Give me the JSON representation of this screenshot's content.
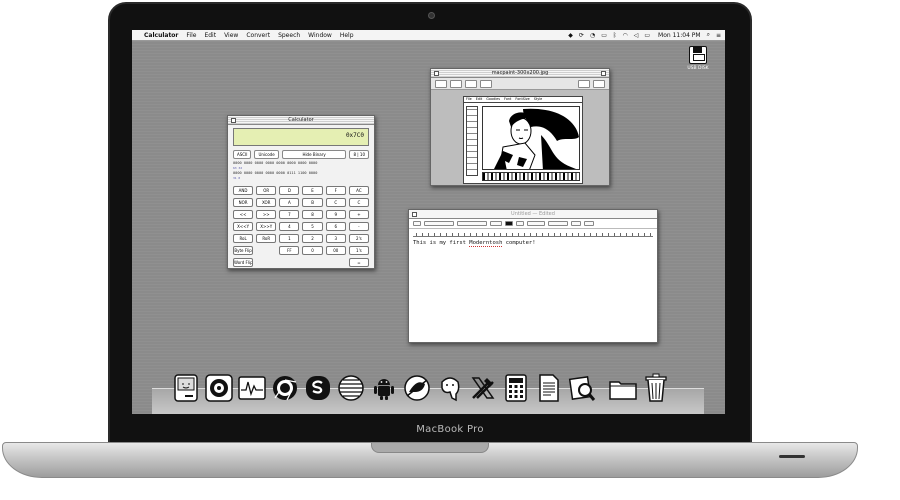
{
  "device": {
    "brand": "MacBook Pro"
  },
  "menubar": {
    "app_name": "Calculator",
    "items": [
      "File",
      "Edit",
      "View",
      "Convert",
      "Speech",
      "Window",
      "Help"
    ],
    "clock": "Mon 11:04 PM"
  },
  "desktop": {
    "disk_label": "USB DISK"
  },
  "calculator": {
    "title": "Calculator",
    "display": "0x7C0",
    "ascii_label": "ASCII",
    "unicode_label": "Unicode",
    "hide_binary_label": "Hide Binary",
    "bits_label": "8 | 10",
    "binary_line_1": "0000 0000 0000 0000 0000 0000 0000 0000",
    "binary_line_2": "0000 0000 0000 0000 0000 0111 1100 0000",
    "binary_index_1": "63                                      32",
    "binary_index_2": "31                                       0",
    "keys": [
      "AND",
      "OR",
      "D",
      "E",
      "F",
      "AC",
      "NOR",
      "XOR",
      "A",
      "B",
      "C",
      "C",
      "<<",
      ">>",
      "7",
      "8",
      "9",
      "+",
      "X<<Y",
      "X>>Y",
      "4",
      "5",
      "6",
      "-",
      "RoL",
      "RoR",
      "1",
      "2",
      "3",
      "2's",
      "Byte Flip",
      "",
      "FF",
      "0",
      "00",
      "1's",
      "Word Flip",
      "",
      "",
      "",
      "",
      "="
    ]
  },
  "paint": {
    "title": "macpaint-300x200.jpg",
    "menus": [
      "File",
      "Edit",
      "Goodies",
      "Font",
      "FontSize",
      "Style"
    ]
  },
  "textedit": {
    "title": "Untitled — Edited",
    "body_before": "This is my first ",
    "body_misspelled": "Moderntosh",
    "body_after": " computer!"
  },
  "dock": {
    "items": [
      "finder-mac-icon",
      "system-preferences-icon",
      "activity-monitor-icon",
      "chrome-icon",
      "skype-icon",
      "safari-icon",
      "android-icon",
      "hog-icon",
      "postgres-icon",
      "xcode-icon",
      "calculator-icon",
      "textedit-icon",
      "preview-icon",
      "folder-icon",
      "trash-icon"
    ]
  }
}
